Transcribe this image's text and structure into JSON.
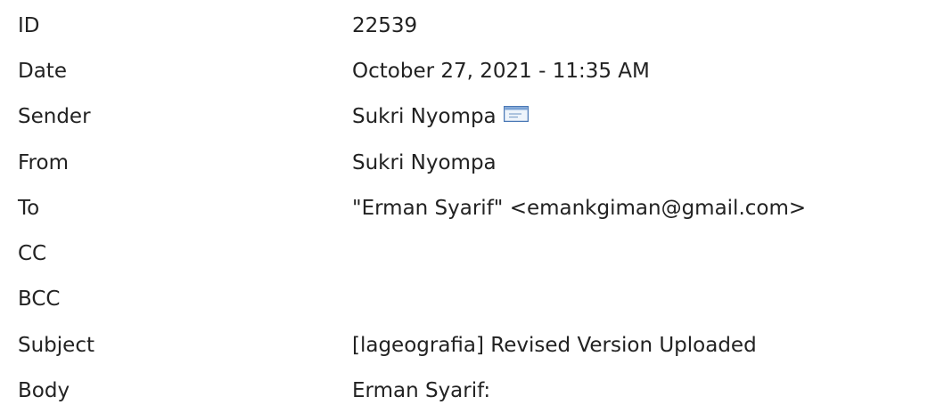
{
  "email": {
    "fields": [
      {
        "label": "ID",
        "value": "22539"
      },
      {
        "label": "Date",
        "value": "October 27, 2021 - 11:35 AM"
      },
      {
        "label": "Sender",
        "value": "Sukri Nyompa",
        "icon": "envelope-icon"
      },
      {
        "label": "From",
        "value": "Sukri Nyompa"
      },
      {
        "label": "To",
        "value": "\"Erman Syarif\" <emankgiman@gmail.com>"
      },
      {
        "label": "CC",
        "value": ""
      },
      {
        "label": "BCC",
        "value": ""
      },
      {
        "label": "Subject",
        "value": "[lageografia] Revised Version Uploaded"
      },
      {
        "label": "Body",
        "value": "Erman Syarif:"
      }
    ]
  }
}
